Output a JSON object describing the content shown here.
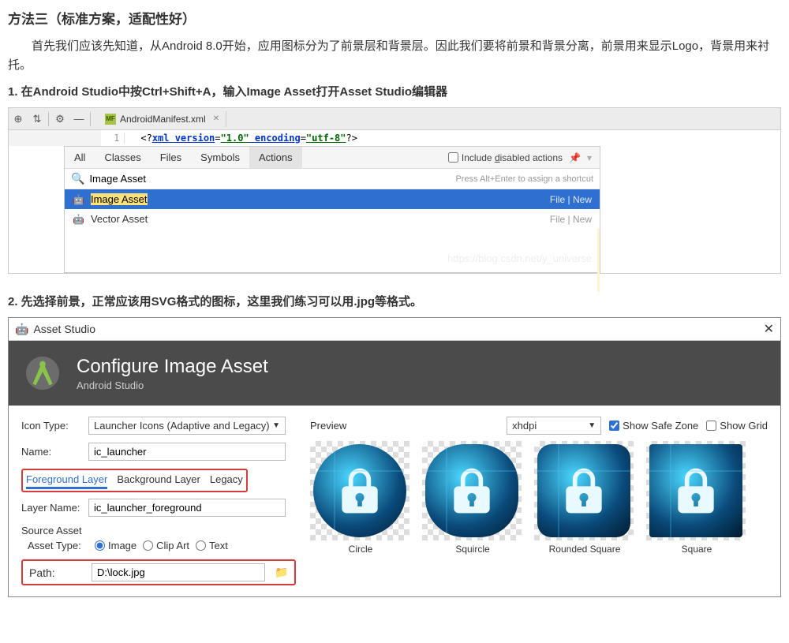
{
  "heading": "方法三（标准方案，适配性好）",
  "intro": "首先我们应该先知道，从Android 8.0开始，应用图标分为了前景层和背景层。因此我们要将前景和背景分离，前景用来显示Logo，背景用来衬托。",
  "step1": "1. 在Android Studio中按Ctrl+Shift+A，输入Image Asset打开Asset Studio编辑器",
  "step2": "2. 先选择前景，正常应该用SVG格式的图标，这里我们练习可以用.jpg等格式。",
  "editor": {
    "file_tab": "AndroidManifest.xml",
    "line_no": "1",
    "xml_prefix": "<?",
    "xml_decl": "xml version",
    "xml_eq1": "=",
    "xml_v1": "\"1.0\"",
    "xml_enc": " encoding",
    "xml_eq2": "=",
    "xml_v2": "\"utf-8\"",
    "xml_suffix": "?>"
  },
  "popup": {
    "tabs": {
      "all": "All",
      "classes": "Classes",
      "files": "Files",
      "symbols": "Symbols",
      "actions": "Actions"
    },
    "include_label": "Include disabled actions",
    "search_value": "Image Asset",
    "hint": "Press Alt+Enter to assign a shortcut",
    "r1_label": "Image Asset",
    "r1_hint": "File | New",
    "r2_label": "Vector Asset",
    "r2_hint": "File | New",
    "watermark": "https://blog.csdn.net/y_universe"
  },
  "dialog": {
    "title": "Asset Studio",
    "hdr_title": "Configure Image Asset",
    "hdr_sub": "Android Studio",
    "icon_type_label": "Icon Type:",
    "icon_type_val": "Launcher Icons (Adaptive and Legacy)",
    "name_label": "Name:",
    "name_val": "ic_launcher",
    "tab_fg": "Foreground Layer",
    "tab_bg": "Background Layer",
    "tab_legacy": "Legacy",
    "layer_name_label": "Layer Name:",
    "layer_name_val": "ic_launcher_foreground",
    "source_asset": "Source Asset",
    "asset_type_label": "Asset Type:",
    "at_image": "Image",
    "at_clip": "Clip Art",
    "at_text": "Text",
    "path_label": "Path:",
    "path_val": "D:\\lock.jpg",
    "preview_label": "Preview",
    "preview_sel": "xhdpi",
    "safe_zone": "Show Safe Zone",
    "show_grid": "Show Grid",
    "pv": {
      "circle": "Circle",
      "squircle": "Squircle",
      "rsquare": "Rounded Square",
      "square": "Square"
    }
  }
}
